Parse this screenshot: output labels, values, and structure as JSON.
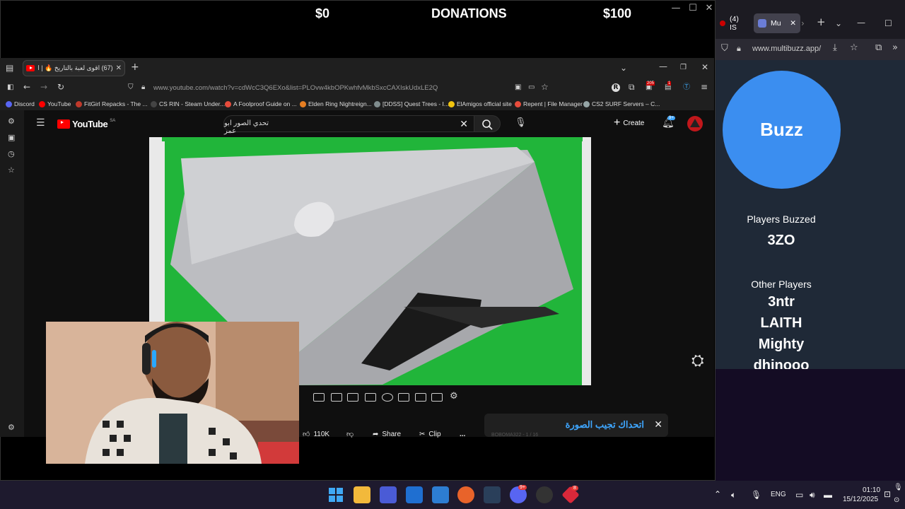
{
  "obs": {
    "donation_min": "$0",
    "donation_title": "DONATIONS",
    "donation_max": "$100"
  },
  "browser": {
    "tab_title": "(67) اقوى لعبة بالتاريخ 🔥 | اتحد",
    "url": "www.youtube.com/watch?v=cdWcC3Q6EXo&list=PLOvw4kbOPKwhfvMkbSxcCAXIskUdxLE2Q",
    "ext_badges": [
      "205",
      "1"
    ],
    "bookmarks": [
      {
        "label": "Discord",
        "color": "#5865f2"
      },
      {
        "label": "YouTube",
        "color": "#ff0000"
      },
      {
        "label": "FitGirl Repacks - The ...",
        "color": "#c0392b"
      },
      {
        "label": "CS RIN - Steam Under...",
        "color": "#444444"
      },
      {
        "label": "A Foolproof Guide on ...",
        "color": "#e74c3c"
      },
      {
        "label": "Elden Ring Nightreign...",
        "color": "#e67e22"
      },
      {
        "label": "[DDSS] Quest Trees - I...",
        "color": "#7f8c8d"
      },
      {
        "label": "ElAmigos official site",
        "color": "#f1c40f"
      },
      {
        "label": "Repent | File Manager",
        "color": "#e74c3c"
      },
      {
        "label": "CS2 SURF Servers – C...",
        "color": "#95a5a6"
      }
    ]
  },
  "youtube": {
    "logo_text": "YouTube",
    "region": "SA",
    "search_value": "تحدي الصور ابو عمر",
    "create_label": "Create",
    "notif_badge": "9+",
    "likes": "110K",
    "share_label": "Share",
    "clip_label": "Clip",
    "more_label": "...",
    "playlist_title": "اتحداك تجيب الصورة",
    "playlist_sub": "BOBOMA322 - 1 / 16"
  },
  "multibuzz": {
    "tab1": "(4) IS",
    "tab2": "Mu",
    "url": "www.multibuzz.app/",
    "buzz_label": "Buzz",
    "players_buzzed_label": "Players Buzzed",
    "buzzed_player": "3ZO",
    "other_players_label": "Other Players",
    "other_players": [
      "3ntr",
      "LAITH",
      "Mighty",
      "dhinooo"
    ]
  },
  "taskbar": {
    "language": "ENG",
    "time": "01:10",
    "date": "15/12/2025",
    "discord_badge": "9+",
    "app_badge": "8"
  }
}
